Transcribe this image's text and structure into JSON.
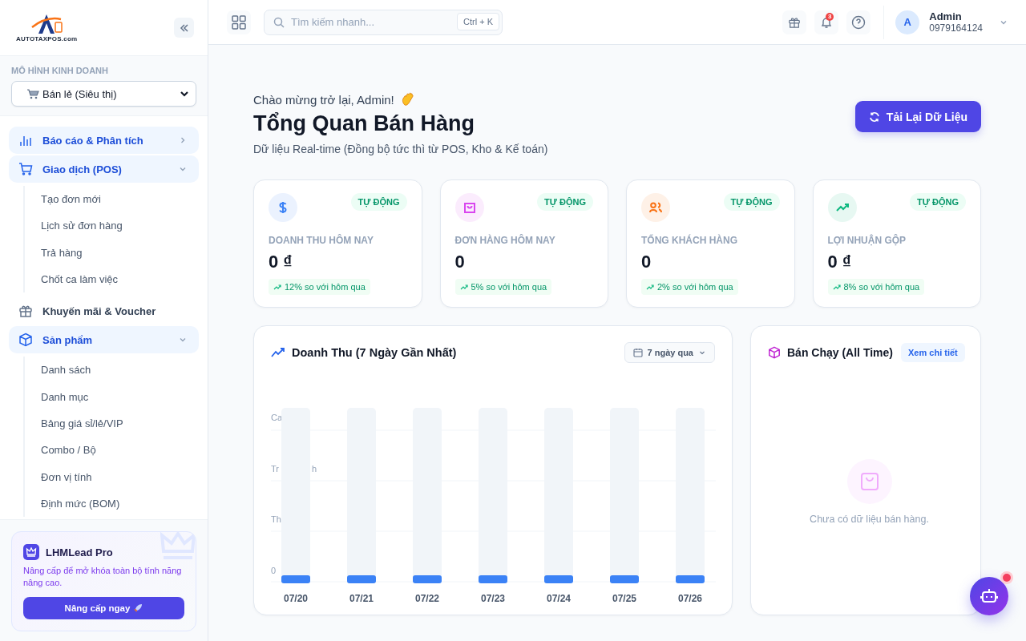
{
  "sidebar": {
    "logo_text": "AUTOTAXPOS.com",
    "section_label": "MÔ HÌNH KINH DOANH",
    "business_model": {
      "value": "Bán lẻ (Siêu thị)"
    },
    "nav": [
      {
        "label": "Báo cáo & Phân tích",
        "kind": "group",
        "active": true,
        "expanded": false
      },
      {
        "label": "Giao dịch (POS)",
        "kind": "group",
        "active": true,
        "expanded": true,
        "children": [
          {
            "label": "Tạo đơn mới"
          },
          {
            "label": "Lịch sử đơn hàng"
          },
          {
            "label": "Trả hàng"
          },
          {
            "label": "Chốt ca làm việc"
          }
        ]
      },
      {
        "label": "Khuyến mãi & Voucher",
        "kind": "link",
        "active": false
      },
      {
        "label": "Sản phẩm",
        "kind": "group",
        "active": true,
        "expanded": true,
        "children": [
          {
            "label": "Danh sách"
          },
          {
            "label": "Danh mục"
          },
          {
            "label": "Bảng giá sỉ/lẻ/VIP"
          },
          {
            "label": "Combo / Bộ"
          },
          {
            "label": "Đơn vị tính"
          },
          {
            "label": "Định mức (BOM)"
          }
        ]
      }
    ],
    "promo": {
      "title": "LHMLead Pro",
      "text": "Nâng cấp để mở khóa toàn bộ tính năng nâng cao.",
      "button": "Nâng cấp ngay"
    }
  },
  "header": {
    "search": {
      "placeholder": "Tìm kiếm nhanh...",
      "shortcut": "Ctrl + K"
    },
    "notifications": "3",
    "user": {
      "initial": "A",
      "name": "Admin",
      "phone": "0979164124"
    }
  },
  "page": {
    "greeting": "Chào mừng trở lại, Admin!",
    "title": "Tổng Quan Bán Hàng",
    "subtitle": "Dữ liệu Real-time (Đồng bộ tức thì từ POS, Kho & Kế toán)",
    "reload_button": "Tải Lại Dữ Liệu"
  },
  "stats": [
    {
      "label": "DOANH THU HÔM NAY",
      "value": "0 ₫",
      "badge": "TỰ ĐỘNG",
      "trend": "12% so với hôm qua",
      "color": "#3b82f6"
    },
    {
      "label": "ĐƠN HÀNG HÔM NAY",
      "value": "0",
      "badge": "TỰ ĐỘNG",
      "trend": "5% so với hôm qua",
      "color": "#d946ef"
    },
    {
      "label": "TỔNG KHÁCH HÀNG",
      "value": "0",
      "badge": "TỰ ĐỘNG",
      "trend": "2% so với hôm qua",
      "color": "#f97316"
    },
    {
      "label": "LỢI NHUẬN GỘP",
      "value": "0 ₫",
      "badge": "TỰ ĐỘNG",
      "trend": "8% so với hôm qua",
      "color": "#10b981"
    }
  ],
  "revenue_chart": {
    "title": "Doanh Thu (7 Ngày Gần Nhất)",
    "range": "7 ngày qua",
    "axis_fragments": [
      "Ca",
      "Tr",
      "h",
      "Th",
      "0"
    ],
    "categories": [
      "07/20",
      "07/21",
      "07/22",
      "07/23",
      "07/24",
      "07/25",
      "07/26"
    ]
  },
  "top_sellers": {
    "title": "Bán Chạy (All Time)",
    "link": "Xem chi tiết",
    "empty": "Chưa có dữ liệu bán hàng."
  }
}
